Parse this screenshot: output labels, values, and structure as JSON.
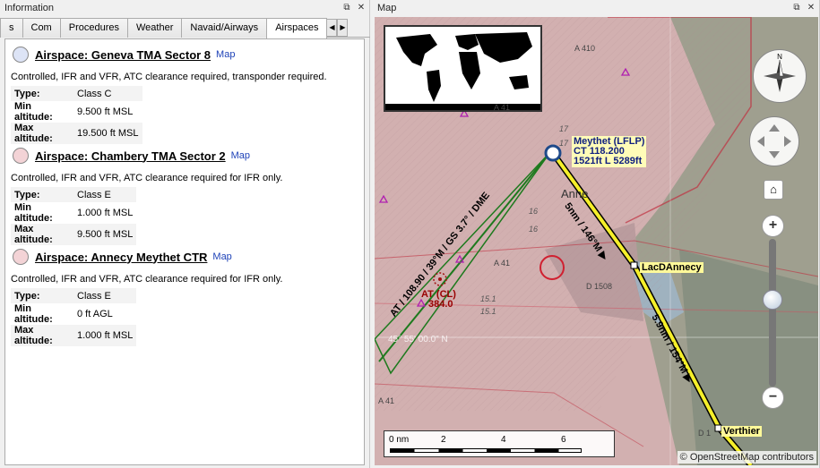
{
  "info_dock": {
    "title": "Information",
    "float_icon": "float-icon",
    "close_icon": "close-icon",
    "tabs": [
      {
        "label": "s",
        "active": false
      },
      {
        "label": "Com",
        "active": false
      },
      {
        "label": "Procedures",
        "active": false
      },
      {
        "label": "Weather",
        "active": false
      },
      {
        "label": "Navaid/Airways",
        "active": false
      },
      {
        "label": "Airspaces",
        "active": true
      }
    ],
    "airspaces": [
      {
        "color": "#c9d4f2",
        "title": "Airspace: Geneva TMA Sector 8",
        "map_link": "Map",
        "desc": "Controlled, IFR and VFR, ATC clearance required, transponder required.",
        "rows": [
          {
            "k": "Type:",
            "v": "Class C"
          },
          {
            "k": "Min altitude:",
            "v": "9.500 ft MSL"
          },
          {
            "k": "Max altitude:",
            "v": "19.500 ft MSL"
          }
        ]
      },
      {
        "color": "#f0c4c8",
        "title": "Airspace: Chambery TMA Sector 2",
        "map_link": "Map",
        "desc": "Controlled, IFR and VFR, ATC clearance required for IFR only.",
        "rows": [
          {
            "k": "Type:",
            "v": "Class E"
          },
          {
            "k": "Min altitude:",
            "v": "1.000 ft MSL"
          },
          {
            "k": "Max altitude:",
            "v": "9.500 ft MSL"
          }
        ]
      },
      {
        "color": "#f0c4c8",
        "title": "Airspace: Annecy Meythet CTR",
        "map_link": "Map",
        "desc": "Controlled, IFR and VFR, ATC clearance required for IFR only.",
        "rows": [
          {
            "k": "Type:",
            "v": "Class E"
          },
          {
            "k": "Min altitude:",
            "v": "0 ft AGL"
          },
          {
            "k": "Max altitude:",
            "v": "1.000 ft MSL"
          }
        ]
      }
    ]
  },
  "map_dock": {
    "title": "Map",
    "airport_label": {
      "line1": "Meythet (LFLP)",
      "line2": "CT 118.200",
      "line3": "1521ft L 5289ft"
    },
    "waypoints": [
      "LacDAnnecy",
      "Verthier"
    ],
    "leg1_label": "5nm / 146°M ▶",
    "leg2_label": "5.9nm / 154°M ▶",
    "ils_label": "AT / 108.90 / 39°M / GS 3.7° / DME",
    "ndb_label": {
      "name": "AT (CL)",
      "freq": "384.0"
    },
    "airway_labels": [
      "A 410",
      "A 41",
      "A 41",
      "A 41",
      "D 1508",
      "D 1"
    ],
    "terrain_numbers": [
      "17",
      "17",
      "16",
      "15.1",
      "15.1",
      "16"
    ],
    "town_label": "Anne",
    "lat_label": "45° 55' 00.0\" N",
    "scale": {
      "labels": [
        "0 nm",
        "2",
        "4",
        "6"
      ]
    },
    "attribution": "© OpenStreetMap contributors",
    "colors": {
      "route": "#f5ef2a",
      "ils": "#1e7a1e",
      "airspace_fill": "#c8a2a6",
      "airspace_line": "#c03040",
      "airspace_green": "#6fc060"
    }
  }
}
